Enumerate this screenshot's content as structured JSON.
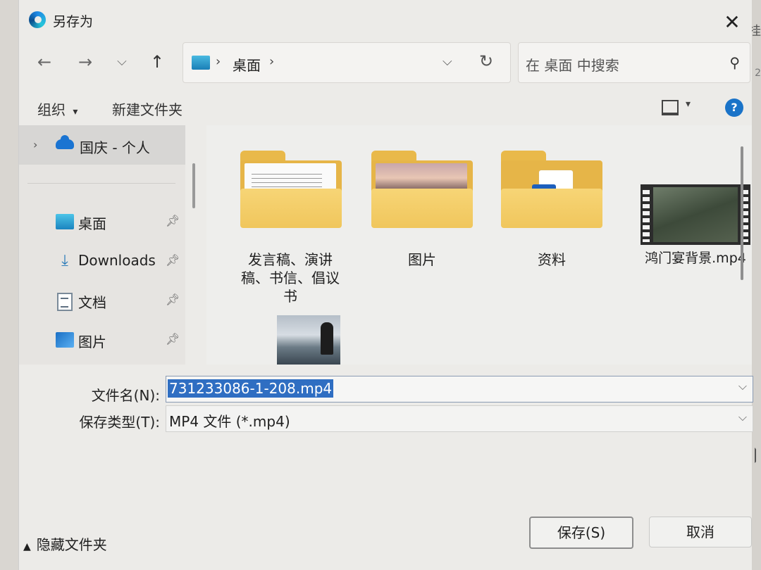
{
  "window": {
    "title": "另存为"
  },
  "address": {
    "location": "桌面"
  },
  "search": {
    "placeholder": "在 桌面 中搜索"
  },
  "commands": {
    "organize": "组织",
    "new_folder": "新建文件夹"
  },
  "nav": {
    "onedrive": "国庆 - 个人",
    "items": [
      {
        "label": "桌面",
        "icon": "desktop-icon"
      },
      {
        "label": "Downloads",
        "icon": "download-icon"
      },
      {
        "label": "文档",
        "icon": "document-icon"
      },
      {
        "label": "图片",
        "icon": "pictures-icon"
      }
    ]
  },
  "files": [
    {
      "name": "发言稿、演讲稿、书信、倡议书",
      "line1": "发言稿、演讲",
      "line2": "稿、书信、倡议",
      "line3": "书",
      "type": "folder"
    },
    {
      "name": "图片",
      "type": "folder"
    },
    {
      "name": "资料",
      "type": "folder"
    },
    {
      "name": "鸿门宴背景.mp4",
      "type": "video"
    },
    {
      "name": "",
      "type": "image"
    }
  ],
  "form": {
    "filename_label": "文件名(N):",
    "filename_value": "731233086-1-208.mp4",
    "filetype_label": "保存类型(T):",
    "filetype_value": "MP4 文件 (*.mp4)"
  },
  "footer": {
    "hide_folders": "隐藏文件夹",
    "save": "保存(S)",
    "cancel": "取消"
  },
  "colors": {
    "accent": "#1a73c8",
    "selection": "#2f6ec2",
    "folder": "#f0c65c"
  }
}
